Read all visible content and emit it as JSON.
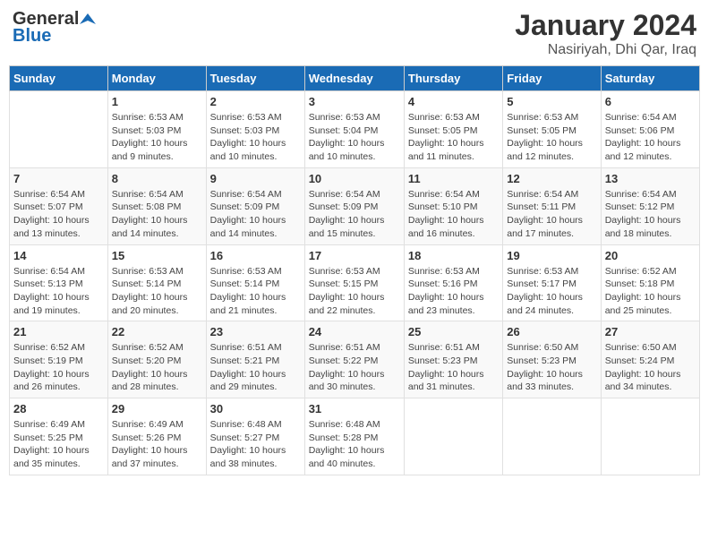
{
  "header": {
    "logo_general": "General",
    "logo_blue": "Blue",
    "month_year": "January 2024",
    "location": "Nasiriyah, Dhi Qar, Iraq"
  },
  "columns": [
    "Sunday",
    "Monday",
    "Tuesday",
    "Wednesday",
    "Thursday",
    "Friday",
    "Saturday"
  ],
  "weeks": [
    [
      {
        "day": "",
        "info": ""
      },
      {
        "day": "1",
        "info": "Sunrise: 6:53 AM\nSunset: 5:03 PM\nDaylight: 10 hours\nand 9 minutes."
      },
      {
        "day": "2",
        "info": "Sunrise: 6:53 AM\nSunset: 5:03 PM\nDaylight: 10 hours\nand 10 minutes."
      },
      {
        "day": "3",
        "info": "Sunrise: 6:53 AM\nSunset: 5:04 PM\nDaylight: 10 hours\nand 10 minutes."
      },
      {
        "day": "4",
        "info": "Sunrise: 6:53 AM\nSunset: 5:05 PM\nDaylight: 10 hours\nand 11 minutes."
      },
      {
        "day": "5",
        "info": "Sunrise: 6:53 AM\nSunset: 5:05 PM\nDaylight: 10 hours\nand 12 minutes."
      },
      {
        "day": "6",
        "info": "Sunrise: 6:54 AM\nSunset: 5:06 PM\nDaylight: 10 hours\nand 12 minutes."
      }
    ],
    [
      {
        "day": "7",
        "info": "Sunrise: 6:54 AM\nSunset: 5:07 PM\nDaylight: 10 hours\nand 13 minutes."
      },
      {
        "day": "8",
        "info": "Sunrise: 6:54 AM\nSunset: 5:08 PM\nDaylight: 10 hours\nand 14 minutes."
      },
      {
        "day": "9",
        "info": "Sunrise: 6:54 AM\nSunset: 5:09 PM\nDaylight: 10 hours\nand 14 minutes."
      },
      {
        "day": "10",
        "info": "Sunrise: 6:54 AM\nSunset: 5:09 PM\nDaylight: 10 hours\nand 15 minutes."
      },
      {
        "day": "11",
        "info": "Sunrise: 6:54 AM\nSunset: 5:10 PM\nDaylight: 10 hours\nand 16 minutes."
      },
      {
        "day": "12",
        "info": "Sunrise: 6:54 AM\nSunset: 5:11 PM\nDaylight: 10 hours\nand 17 minutes."
      },
      {
        "day": "13",
        "info": "Sunrise: 6:54 AM\nSunset: 5:12 PM\nDaylight: 10 hours\nand 18 minutes."
      }
    ],
    [
      {
        "day": "14",
        "info": "Sunrise: 6:54 AM\nSunset: 5:13 PM\nDaylight: 10 hours\nand 19 minutes."
      },
      {
        "day": "15",
        "info": "Sunrise: 6:53 AM\nSunset: 5:14 PM\nDaylight: 10 hours\nand 20 minutes."
      },
      {
        "day": "16",
        "info": "Sunrise: 6:53 AM\nSunset: 5:14 PM\nDaylight: 10 hours\nand 21 minutes."
      },
      {
        "day": "17",
        "info": "Sunrise: 6:53 AM\nSunset: 5:15 PM\nDaylight: 10 hours\nand 22 minutes."
      },
      {
        "day": "18",
        "info": "Sunrise: 6:53 AM\nSunset: 5:16 PM\nDaylight: 10 hours\nand 23 minutes."
      },
      {
        "day": "19",
        "info": "Sunrise: 6:53 AM\nSunset: 5:17 PM\nDaylight: 10 hours\nand 24 minutes."
      },
      {
        "day": "20",
        "info": "Sunrise: 6:52 AM\nSunset: 5:18 PM\nDaylight: 10 hours\nand 25 minutes."
      }
    ],
    [
      {
        "day": "21",
        "info": "Sunrise: 6:52 AM\nSunset: 5:19 PM\nDaylight: 10 hours\nand 26 minutes."
      },
      {
        "day": "22",
        "info": "Sunrise: 6:52 AM\nSunset: 5:20 PM\nDaylight: 10 hours\nand 28 minutes."
      },
      {
        "day": "23",
        "info": "Sunrise: 6:51 AM\nSunset: 5:21 PM\nDaylight: 10 hours\nand 29 minutes."
      },
      {
        "day": "24",
        "info": "Sunrise: 6:51 AM\nSunset: 5:22 PM\nDaylight: 10 hours\nand 30 minutes."
      },
      {
        "day": "25",
        "info": "Sunrise: 6:51 AM\nSunset: 5:23 PM\nDaylight: 10 hours\nand 31 minutes."
      },
      {
        "day": "26",
        "info": "Sunrise: 6:50 AM\nSunset: 5:23 PM\nDaylight: 10 hours\nand 33 minutes."
      },
      {
        "day": "27",
        "info": "Sunrise: 6:50 AM\nSunset: 5:24 PM\nDaylight: 10 hours\nand 34 minutes."
      }
    ],
    [
      {
        "day": "28",
        "info": "Sunrise: 6:49 AM\nSunset: 5:25 PM\nDaylight: 10 hours\nand 35 minutes."
      },
      {
        "day": "29",
        "info": "Sunrise: 6:49 AM\nSunset: 5:26 PM\nDaylight: 10 hours\nand 37 minutes."
      },
      {
        "day": "30",
        "info": "Sunrise: 6:48 AM\nSunset: 5:27 PM\nDaylight: 10 hours\nand 38 minutes."
      },
      {
        "day": "31",
        "info": "Sunrise: 6:48 AM\nSunset: 5:28 PM\nDaylight: 10 hours\nand 40 minutes."
      },
      {
        "day": "",
        "info": ""
      },
      {
        "day": "",
        "info": ""
      },
      {
        "day": "",
        "info": ""
      }
    ]
  ]
}
